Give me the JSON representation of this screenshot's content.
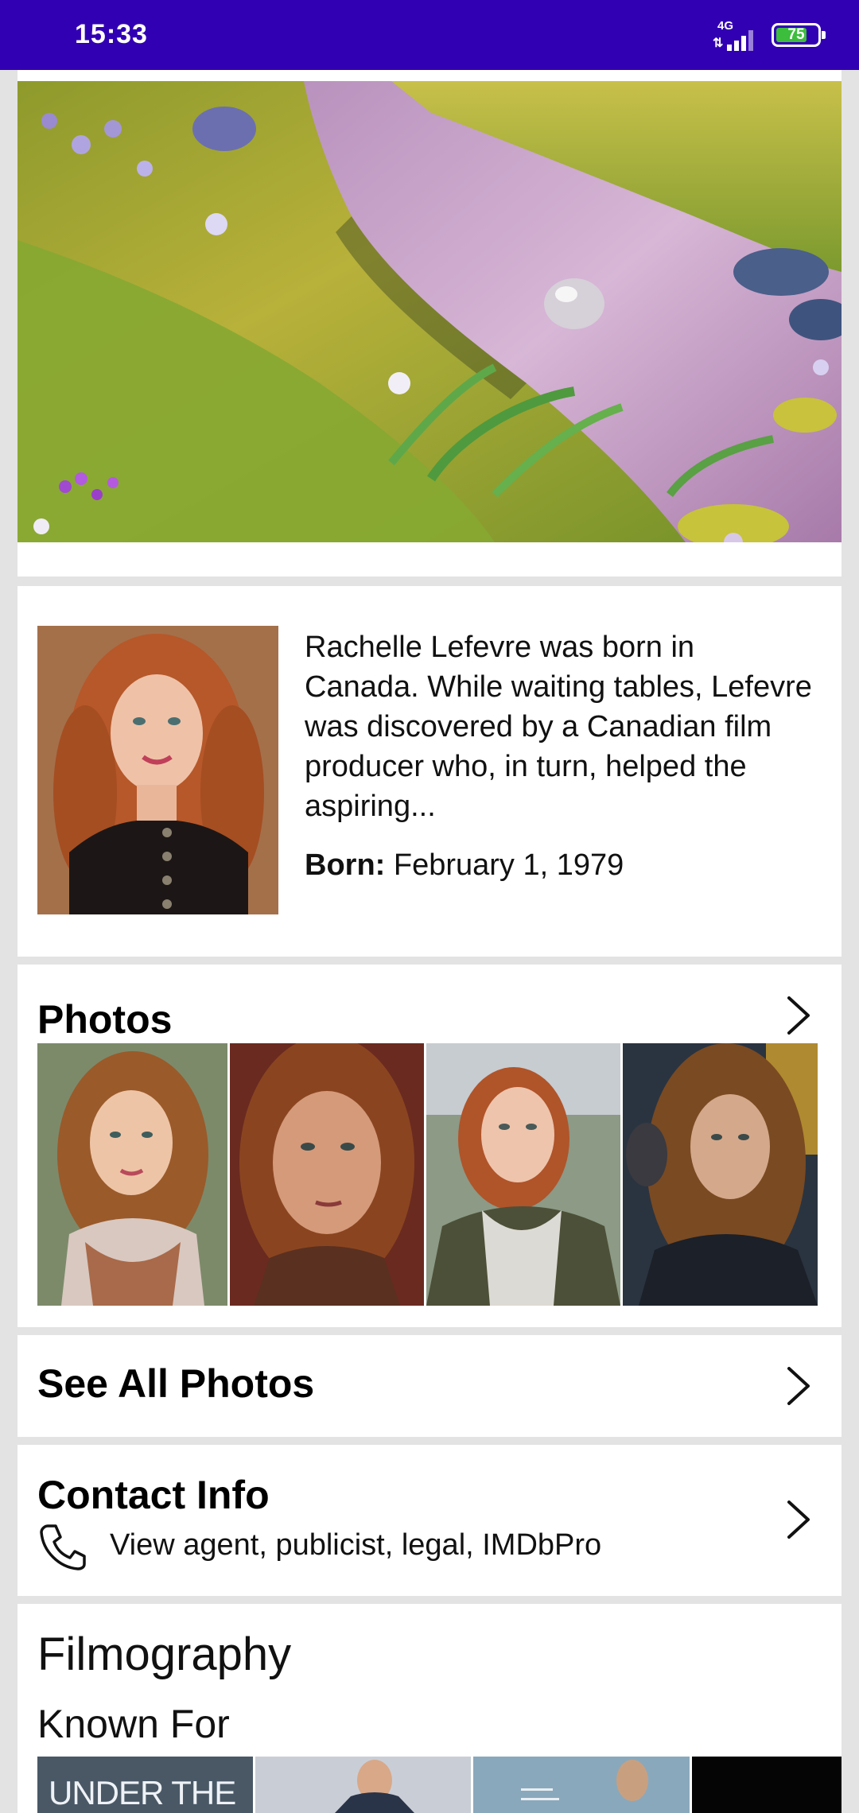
{
  "status_bar": {
    "time": "15:33",
    "network": "4G",
    "battery": "75",
    "battery_level_percent": 75
  },
  "hero": {
    "image_alt": "Animated grassy meadow with a pink stream"
  },
  "bio": {
    "text": "Rachelle Lefevre was born in Canada. While waiting tables, Lefevre was discovered by a Canadian film producer who, in turn, helped the aspiring...",
    "born_label": "Born:",
    "born_value": "February 1, 1979"
  },
  "photos": {
    "title": "Photos",
    "count_visible": 4
  },
  "see_all": {
    "label": "See All Photos"
  },
  "contact": {
    "title": "Contact Info",
    "subtitle": "View agent, publicist, legal, IMDbPro"
  },
  "filmography": {
    "title": "Filmography",
    "known_for": "Known For",
    "posters": [
      {
        "text": "UNDER THE"
      },
      {
        "text": ""
      },
      {
        "text": ""
      },
      {
        "text": ""
      }
    ]
  },
  "icons": {
    "chevron": "chevron-right-icon",
    "phone": "phone-icon"
  }
}
